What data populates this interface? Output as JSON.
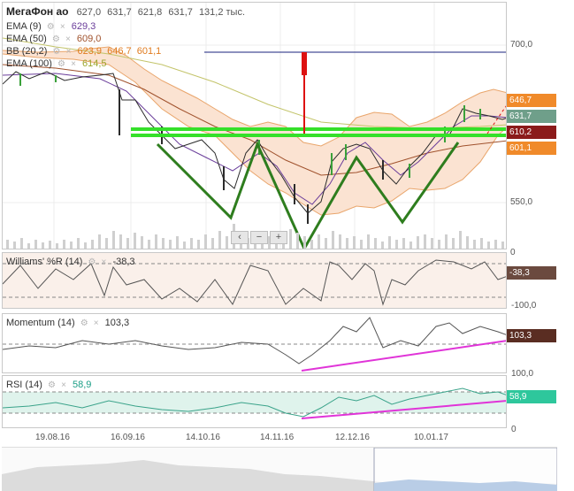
{
  "header": {
    "ticker": "МегаФон ао",
    "open": "627,0",
    "high": "631,7",
    "low": "621,8",
    "close": "631,7",
    "volume": "131,2 тыс."
  },
  "indicators": [
    {
      "name": "EMA (9)",
      "value": "629,3",
      "color": "#6a3d9a"
    },
    {
      "name": "EMA (50)",
      "value": "609,0",
      "color": "#a0522d"
    },
    {
      "name": "BB (20,2)",
      "value": "623,9  646,7  601,1",
      "color": "#e07b1e"
    },
    {
      "name": "EMA (100)",
      "value": "614,5",
      "color": "#b8c44a"
    }
  ],
  "price_axis": {
    "top_label": "700,0",
    "bottom_label": "550,0",
    "volume_zero": "0"
  },
  "price_tags": [
    {
      "label": "646,7",
      "color": "#f08a2a"
    },
    {
      "label": "631,7",
      "color": "#6f9f8a"
    },
    {
      "label": "610,2",
      "color": "#8b1a1a"
    },
    {
      "label": "601,1",
      "color": "#f08a2a"
    }
  ],
  "williams": {
    "title": "Williams' %R (14)",
    "value": "-38,3",
    "tag": "-38,3",
    "axis_bottom": "-100,0"
  },
  "momentum": {
    "title": "Momentum (14)",
    "value": "103,3",
    "tag": "103,3",
    "axis_bottom": "100,0"
  },
  "rsi": {
    "title": "RSI (14)",
    "value": "58,9",
    "tag": "58,9",
    "axis_bottom": "0"
  },
  "time_axis": [
    "19.08.16",
    "16.09.16",
    "14.10.16",
    "14.11.16",
    "12.12.16",
    "10.01.17"
  ],
  "nav": {
    "left": "‹",
    "minus": "−",
    "plus": "+"
  },
  "colors": {
    "grid": "#e6e6e6",
    "candle_up": "#3aa13a",
    "candle_down": "#2b2b2b",
    "bb_fill": "#fbe3d2",
    "pattern": "#2e7d1e",
    "support": "#35e02a",
    "magenta": "#e034d8",
    "red": "#dd1111",
    "blue_line": "#1a237e"
  }
}
